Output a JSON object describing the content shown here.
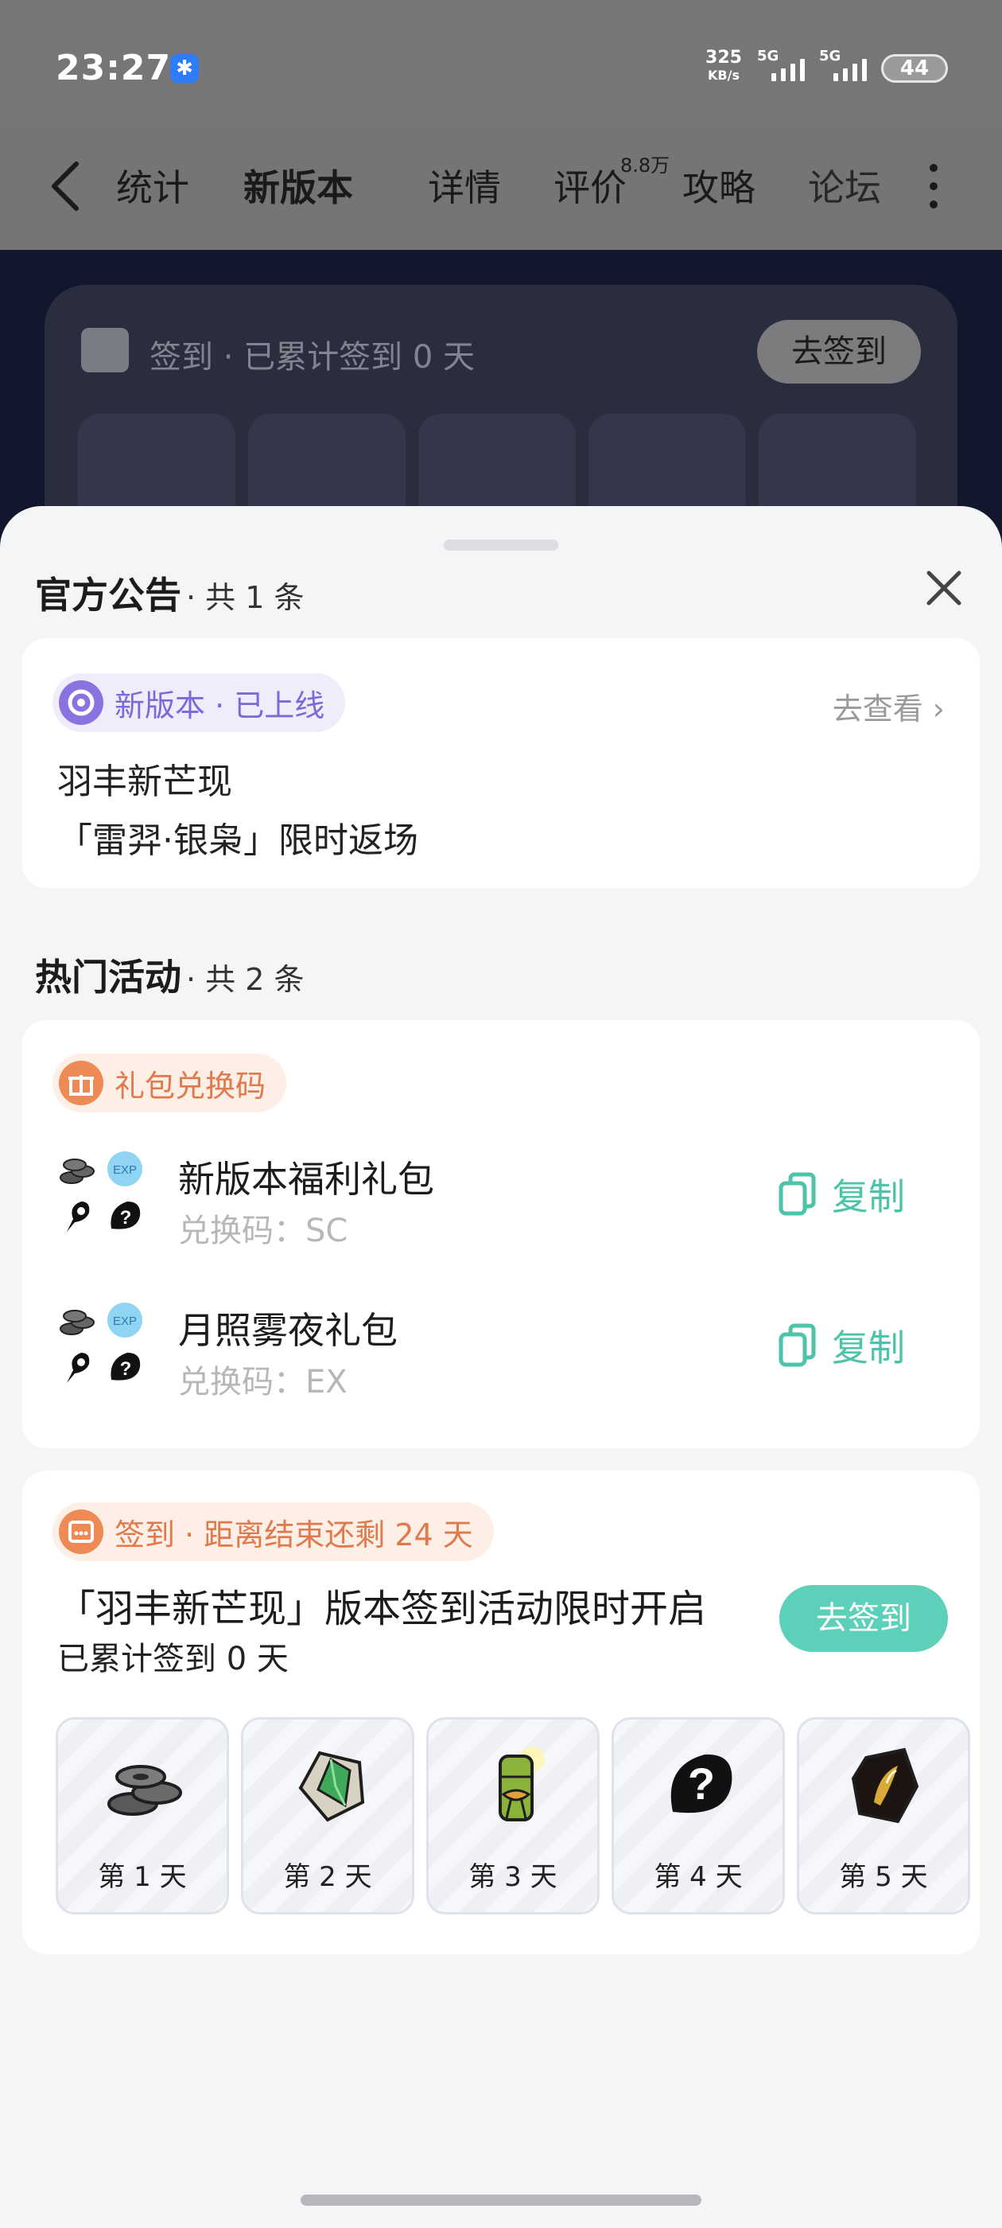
{
  "status_bar": {
    "time": "23:27",
    "net_speed_value": "325",
    "net_speed_unit": "KB/s",
    "signal_1_label": "5G",
    "signal_2_label": "5G",
    "battery": "44"
  },
  "nav": {
    "tabs": [
      "统计",
      "新版本",
      "详情",
      "评价",
      "攻略",
      "论坛"
    ],
    "active_tab": "新版本",
    "rating_badge": "8.8万"
  },
  "background_card": {
    "text": "签到 · 已累计签到 0 天",
    "button": "去签到"
  },
  "sheet": {
    "announcement_section": {
      "title": "官方公告",
      "count": "· 共 1 条",
      "tag": "新版本 · 已上线",
      "link": "去查看",
      "line1": "羽丰新芒现",
      "line2": "「雷羿·银枭」限时返场"
    },
    "activity_section": {
      "title": "热门活动",
      "count": "· 共 2 条"
    },
    "gift_card": {
      "tag": "礼包兑换码",
      "items": [
        {
          "name": "新版本福利礼包",
          "code_label": "兑换码：SC",
          "copy": "复制"
        },
        {
          "name": "月照雾夜礼包",
          "code_label": "兑换码：EX",
          "copy": "复制"
        }
      ]
    },
    "checkin_card": {
      "tag": "签到 · 距离结束还剩 24 天",
      "title": "「羽丰新芒现」版本签到活动限时开启",
      "subtitle": "已累计签到 0 天",
      "button": "去签到",
      "days": [
        {
          "label": "第 1 天",
          "reward_icon": "coins-icon"
        },
        {
          "label": "第 2 天",
          "reward_icon": "green-crystal-icon"
        },
        {
          "label": "第 3 天",
          "reward_icon": "bamboo-gift-icon"
        },
        {
          "label": "第 4 天",
          "reward_icon": "mystery-question-icon"
        },
        {
          "label": "第 5 天",
          "reward_icon": "gold-shard-icon"
        }
      ]
    }
  },
  "colors": {
    "accent_green": "#5dd0ba",
    "copy_green": "#4dc4a9",
    "purple_tag": "#7c69d8",
    "orange_tag": "#e07a4c",
    "overlay": "#767676"
  }
}
